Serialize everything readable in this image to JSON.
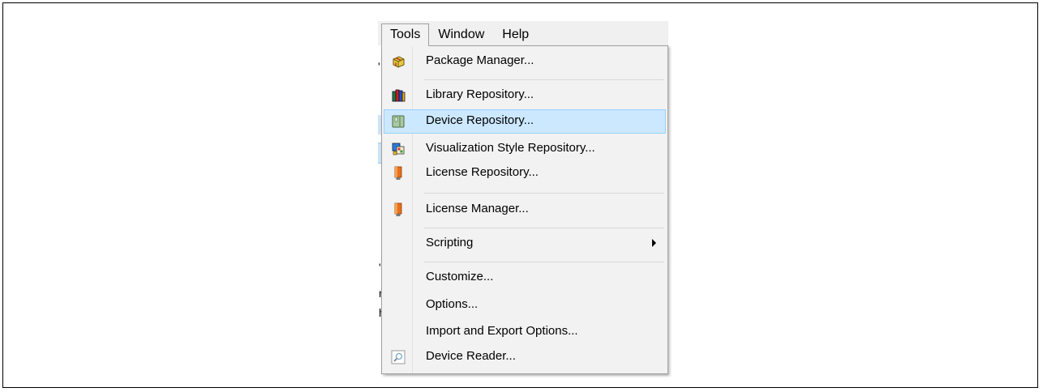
{
  "menubar": {
    "items": [
      {
        "label": "Tools",
        "open": true
      },
      {
        "label": "Window",
        "open": false
      },
      {
        "label": "Help",
        "open": false
      }
    ]
  },
  "background_fragments": [
    "'",
    "'I",
    "r",
    "h"
  ],
  "tools_menu": {
    "items": [
      {
        "label": "Package Manager...",
        "icon": "package-icon"
      },
      {
        "label": "Library Repository...",
        "icon": "library-books-icon"
      },
      {
        "label": "Device Repository...",
        "icon": "device-icon",
        "highlighted": true
      },
      {
        "label": "Visualization Style Repository...",
        "icon": "visualization-style-icon"
      },
      {
        "label": "License Repository...",
        "icon": "license-key-icon"
      },
      {
        "label": "License Manager...",
        "icon": "license-key-icon"
      },
      {
        "label": "Scripting",
        "icon": "",
        "submenu": true
      },
      {
        "label": "Customize...",
        "icon": ""
      },
      {
        "label": "Options...",
        "icon": ""
      },
      {
        "label": "Import and Export Options...",
        "icon": ""
      },
      {
        "label": "Device Reader...",
        "icon": "device-reader-icon"
      }
    ]
  },
  "colors": {
    "highlight": "#cce8ff",
    "highlight_border": "#99d1ff",
    "menu_bg": "#f2f2f2"
  }
}
